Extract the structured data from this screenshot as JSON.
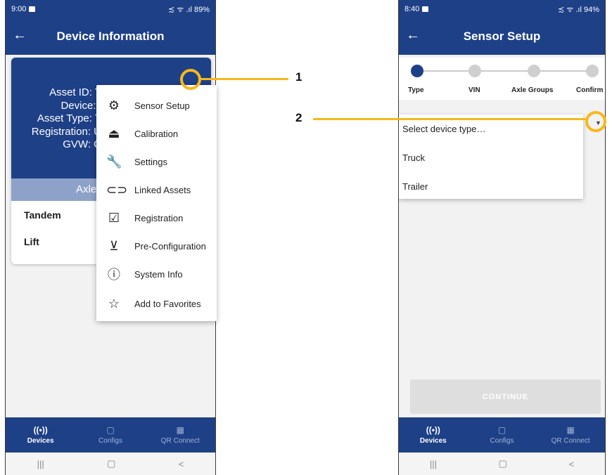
{
  "left_phone": {
    "status": {
      "time": "9:00",
      "right": "≾ ᯤ .ıl 89%"
    },
    "title": "Device Information",
    "info_lines": [
      "Asset ID: T",
      "Device: i",
      "Asset Type: T",
      "Registration: U",
      "GVW: C"
    ],
    "axle_header": "Axle",
    "axle_rows": [
      "Tandem",
      "Lift"
    ],
    "menu_items": [
      {
        "icon": "gear-icon",
        "glyph": "⚙",
        "label": "Sensor Setup"
      },
      {
        "icon": "weight-icon",
        "glyph": "⏏",
        "label": "Calibration"
      },
      {
        "icon": "wrench-icon",
        "glyph": "🔧",
        "label": "Settings"
      },
      {
        "icon": "link-icon",
        "glyph": "⊂⊃",
        "label": "Linked Assets"
      },
      {
        "icon": "registration-icon",
        "glyph": "☑",
        "label": "Registration"
      },
      {
        "icon": "download-box-icon",
        "glyph": "⊻",
        "label": "Pre-Configuration"
      },
      {
        "icon": "info-icon",
        "glyph": "ⓘ",
        "label": "System Info"
      },
      {
        "icon": "star-icon",
        "glyph": "☆",
        "label": "Add to Favorites"
      }
    ]
  },
  "right_phone": {
    "status": {
      "time": "8:40",
      "right": "≾ ᯤ .ıl 94%"
    },
    "title": "Sensor Setup",
    "steps": [
      "Type",
      "VIN",
      "Axle Groups",
      "Confirm"
    ],
    "dropdown_options": [
      "Select device type…",
      "Truck",
      "Trailer"
    ],
    "continue_label": "CONTINUE"
  },
  "bottom_nav": [
    {
      "icon": "devices-icon",
      "glyph": "((•))",
      "label": "Devices"
    },
    {
      "icon": "configs-icon",
      "glyph": "▢",
      "label": "Configs"
    },
    {
      "icon": "qr-icon",
      "glyph": "▦",
      "label": "QR Connect"
    }
  ],
  "callouts": [
    "1",
    "2"
  ],
  "colors": {
    "primary": "#1e4087",
    "accent": "#f7b81a",
    "band": "#8ea2c9"
  }
}
